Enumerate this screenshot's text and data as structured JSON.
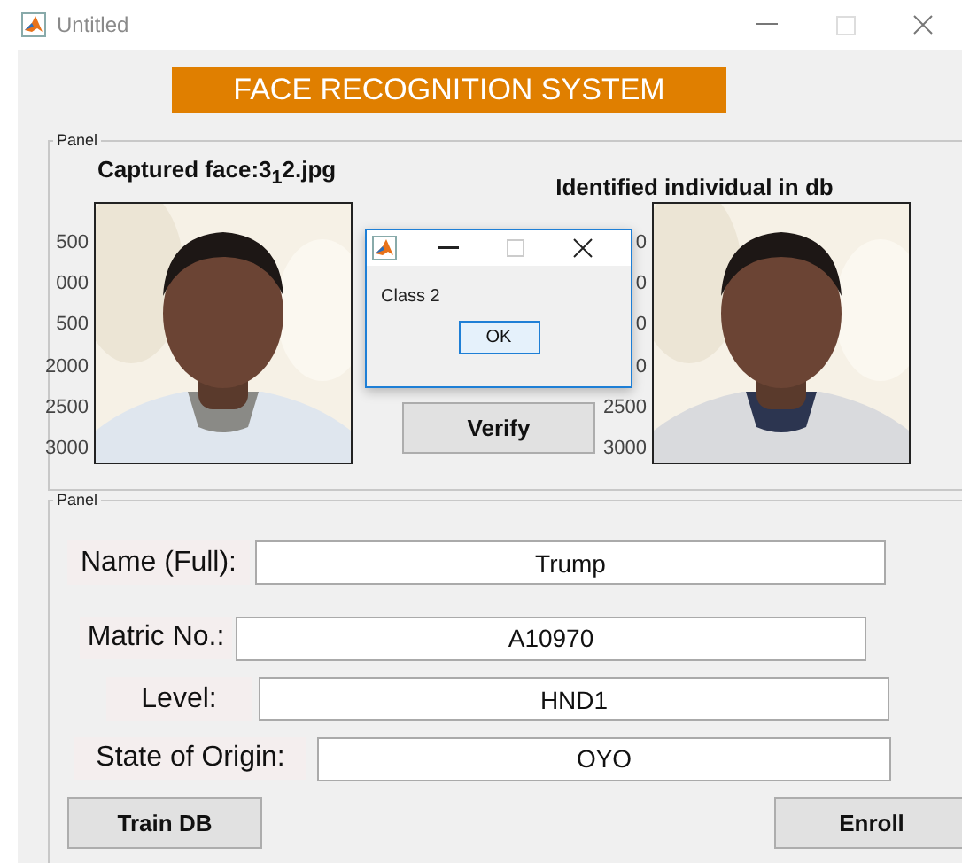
{
  "window": {
    "title": "Untitled"
  },
  "banner": "FACE RECOGNITION SYSTEM",
  "top_panel": {
    "label": "Panel",
    "captured": {
      "title": "Captured face:3$_{1}$2.jpg",
      "y_ticks": [
        "500",
        "000",
        "500",
        "2000",
        "2500",
        "3000"
      ]
    },
    "identified": {
      "title": "Identified individual in db",
      "y_ticks": [
        "0",
        "0",
        "0",
        "0",
        "2500",
        "3000"
      ]
    },
    "verify_button": "Verify"
  },
  "dialog": {
    "message": "Class 2",
    "button": "OK"
  },
  "bottom_panel": {
    "label": "Panel",
    "fields": [
      {
        "label": "Name (Full):",
        "value": "Trump"
      },
      {
        "label": "Matric No.:",
        "value": "A10970"
      },
      {
        "label": "Level:",
        "value": "HND1"
      },
      {
        "label": "State of Origin:",
        "value": "OYO"
      }
    ],
    "buttons": [
      "Train DB",
      "Enroll"
    ]
  }
}
